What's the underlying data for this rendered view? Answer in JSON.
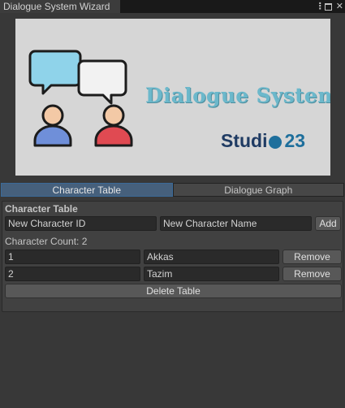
{
  "window": {
    "title": "Dialogue System Wizard",
    "kebab_label": "⋮",
    "close_label": "✕"
  },
  "banner": {
    "title": "Dialogue System",
    "studio_prefix": "Studi",
    "studio_number": "23"
  },
  "tabs": [
    {
      "label": "Character Table",
      "active": true
    },
    {
      "label": "Dialogue Graph",
      "active": false
    }
  ],
  "character_table": {
    "heading": "Character Table",
    "new_id_placeholder": "New Character ID",
    "new_name_placeholder": "New Character Name",
    "add_label": "Add",
    "count_label": "Character Count: 2",
    "rows": [
      {
        "id": "1",
        "name": "Akkas",
        "remove_label": "Remove"
      },
      {
        "id": "2",
        "name": "Tazim",
        "remove_label": "Remove"
      }
    ],
    "delete_label": "Delete Table"
  },
  "colors": {
    "accent": "#46607c",
    "background": "#383838",
    "banner_title": "#6cb8cb",
    "studio_blue": "#1f3b63",
    "person_left": "#6f8fd9",
    "person_right": "#e04a52",
    "bubble_left": "#8fd3ea"
  },
  "icons": [
    "kebab-menu-icon",
    "maximize-icon",
    "close-icon",
    "chat-bubbles-icon",
    "gear-icon"
  ]
}
